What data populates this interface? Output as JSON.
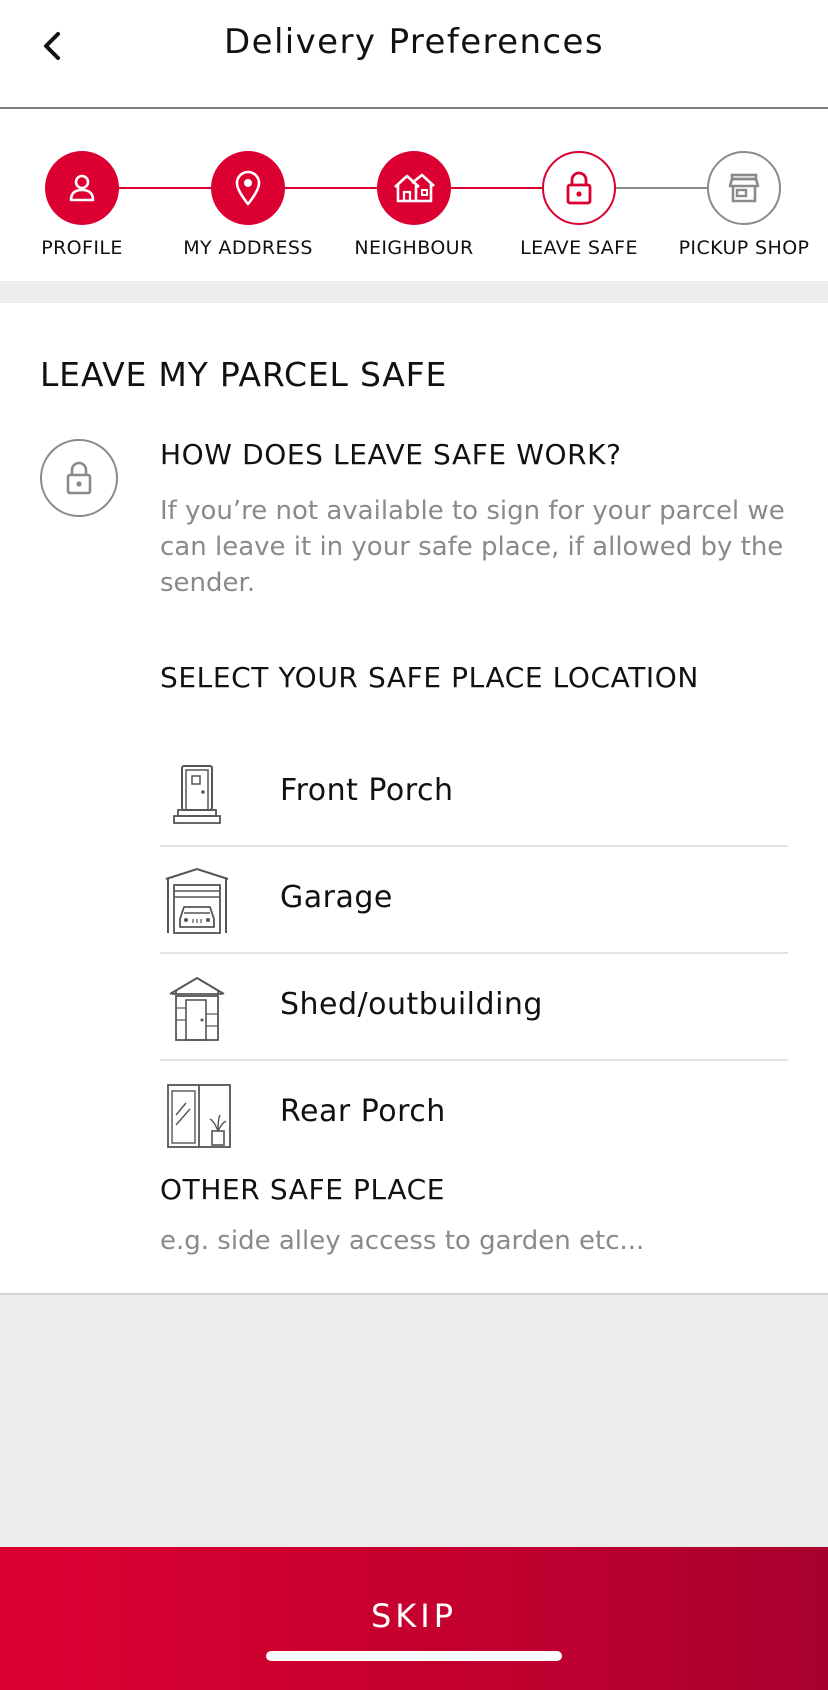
{
  "header": {
    "title": "Delivery Preferences",
    "back_icon": "chevron-left-icon"
  },
  "colors": {
    "brand_red": "#dc0032",
    "inactive_gray": "#8a8a8a",
    "page_bg": "#ececec"
  },
  "steps": [
    {
      "label": "PROFILE",
      "icon": "person-icon",
      "state": "done"
    },
    {
      "label": "MY ADDRESS",
      "icon": "location-pin-icon",
      "state": "done"
    },
    {
      "label": "NEIGHBOUR",
      "icon": "houses-icon",
      "state": "done"
    },
    {
      "label": "LEAVE SAFE",
      "icon": "lock-icon",
      "state": "current"
    },
    {
      "label": "PICKUP SHOP",
      "icon": "shop-icon",
      "state": "todo"
    }
  ],
  "section": {
    "title": "LEAVE MY PARCEL SAFE",
    "info_title": "HOW DOES LEAVE SAFE WORK?",
    "info_text": "If you’re not available to sign for your parcel we can leave it in your safe place, if allowed by the sender.",
    "select_title": "SELECT YOUR SAFE PLACE LOCATION",
    "locations": [
      {
        "label": "Front Porch",
        "icon": "front-door-icon"
      },
      {
        "label": "Garage",
        "icon": "garage-icon"
      },
      {
        "label": "Shed/outbuilding",
        "icon": "shed-icon"
      },
      {
        "label": "Rear Porch",
        "icon": "rear-porch-icon"
      }
    ],
    "other_title": "OTHER SAFE PLACE",
    "other_placeholder": "e.g. side alley access to garden etc...",
    "other_value": ""
  },
  "footer": {
    "skip_label": "SKIP"
  }
}
